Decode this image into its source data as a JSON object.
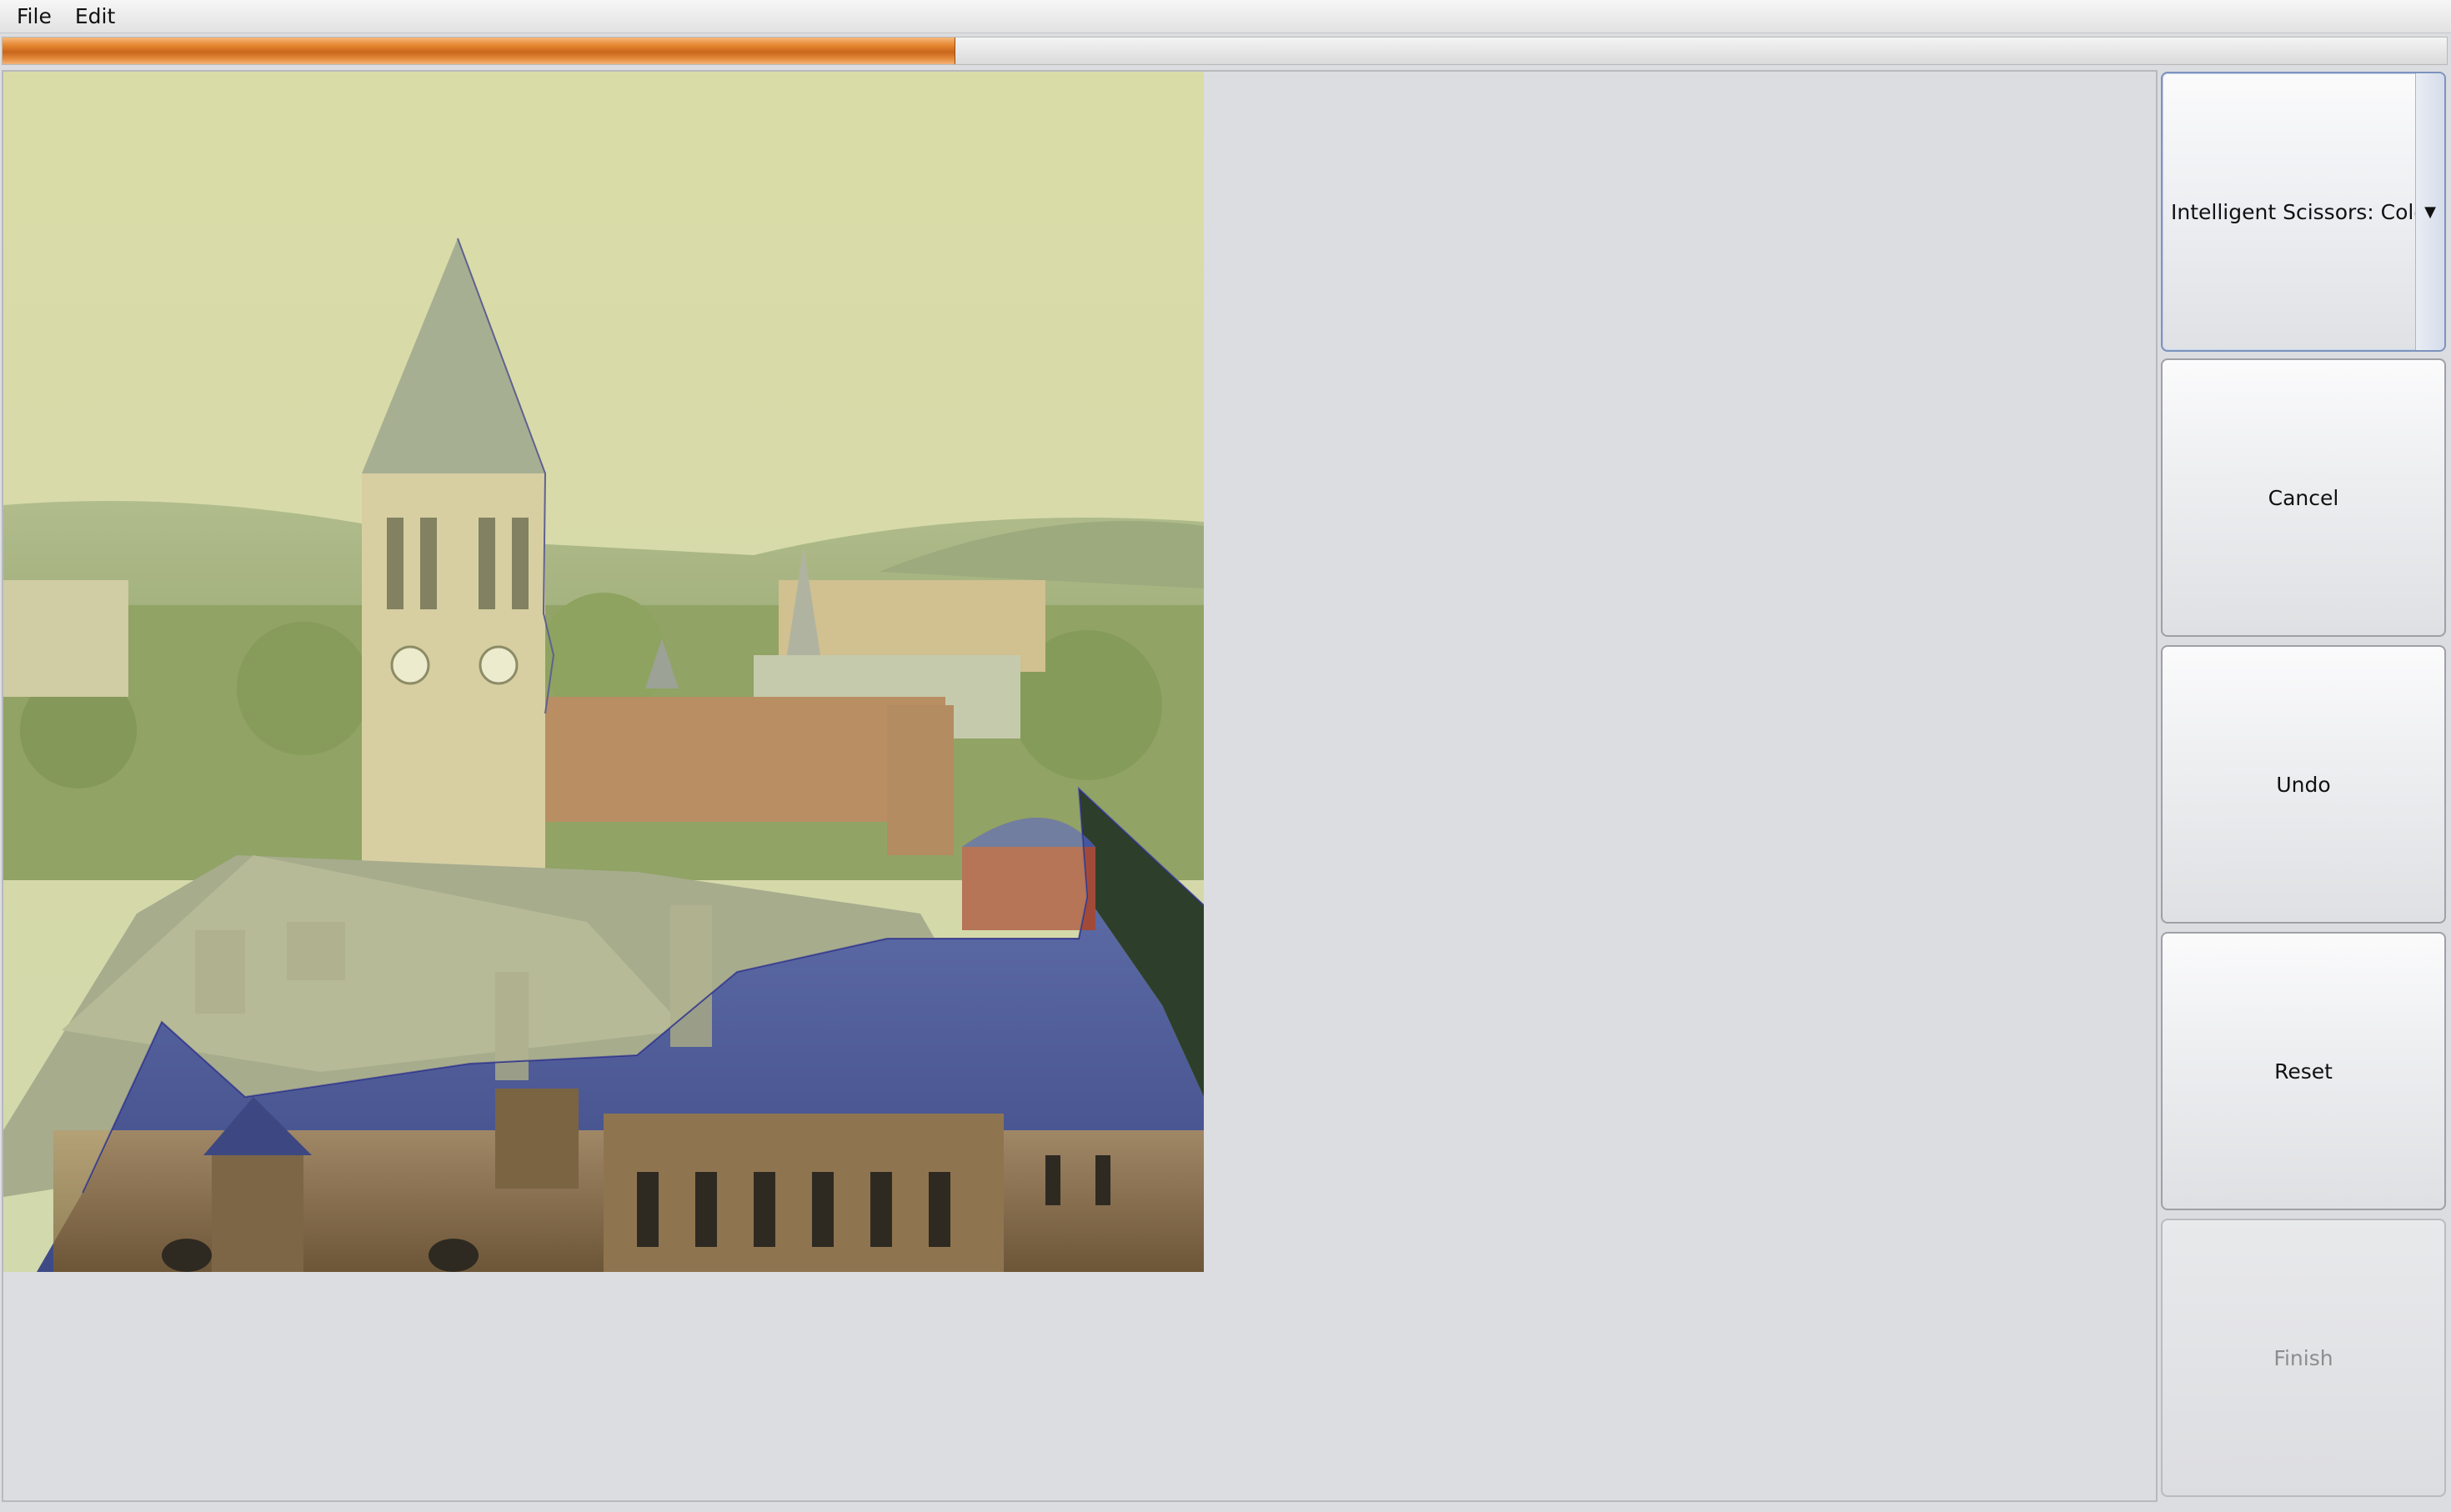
{
  "menu": {
    "items": [
      "File",
      "Edit"
    ]
  },
  "progress": {
    "value_fraction": 0.39,
    "color": "#e4852f"
  },
  "toolbar": {
    "mode_select": {
      "selected": "Intelligent Scissors: Color",
      "arrow_glyph": "▼"
    },
    "cancel_label": "Cancel",
    "undo_label": "Undo",
    "reset_label": "Reset",
    "finish_label": "Finish"
  },
  "colors": {
    "selection_tint": "#3a4aa8",
    "unselected_overlay": "#e8e6a0",
    "boundary_line": "#2a2f8a"
  }
}
